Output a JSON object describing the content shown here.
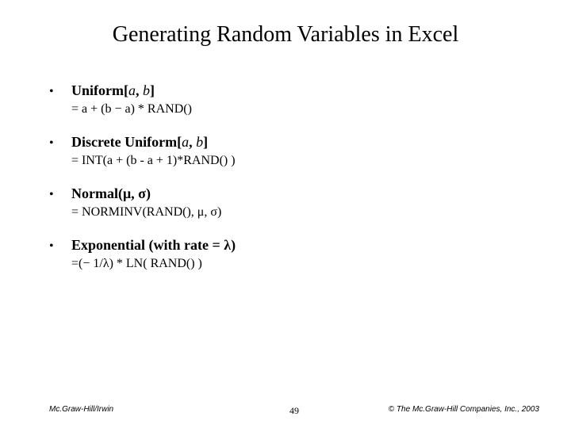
{
  "title": "Generating Random Variables in Excel",
  "items": [
    {
      "heading_html": "<span class='bold'>Uniform[</span><span class='ital'>a</span><span class='bold'>, </span><span class='ital'>b</span><span class='bold'>]</span>",
      "formula": "= a + (b − a) * RAND()"
    },
    {
      "heading_html": "<span class='bold'>Discrete Uniform[</span><span class='ital'>a</span><span class='bold'>, </span><span class='ital'>b</span><span class='bold'>]</span>",
      "formula": "= INT(a + (b - a + 1)*RAND() )"
    },
    {
      "heading_html": "<span class='bold'>Normal(μ, σ)</span>",
      "formula": "= NORMINV(RAND(), μ, σ)"
    },
    {
      "heading_html": "<span class='bold'>Exponential (with rate = λ)</span>",
      "formula": "=(− 1/λ) * LN( RAND() )"
    }
  ],
  "footer": {
    "left": "Mc.Graw-Hill/Irwin",
    "page": "49",
    "right": "© The Mc.Graw-Hill Companies, Inc., 2003"
  }
}
